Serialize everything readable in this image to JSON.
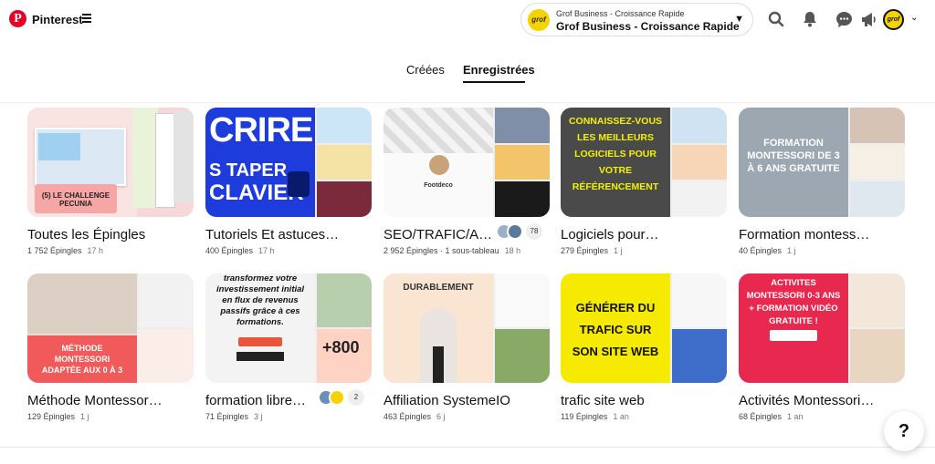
{
  "header": {
    "brand": "Pinterest",
    "account_line1": "Grof Business - Croissance Rapide",
    "account_line2": "Grof Business - Croissance Rapide",
    "avatar_text": "grof"
  },
  "tabs": {
    "created": "Créées",
    "saved": "Enregistrées"
  },
  "boards": [
    {
      "title": "Toutes les Épingles",
      "pins": "1 752 Épingles",
      "time": "17 h",
      "cover_text": "(5) LE CHALLENGE PECUNIA"
    },
    {
      "title": "Tutoriels Et astuces…",
      "pins": "400 Épingles",
      "time": "17 h",
      "cover_text": "CRIRE S TAPER CLAVIER"
    },
    {
      "title": "SEO/TRAFIC/A…",
      "pins": "2 952 Épingles",
      "sub": "1 sous-tableau",
      "time": "18 h",
      "collab_count": "78",
      "cover_text": "Footdeco"
    },
    {
      "title": "Logiciels pour…",
      "pins": "279 Épingles",
      "time": "1 j",
      "cover_text": "CONNAISSEZ-VOUS LES MEILLEURS LOGICIELS POUR VOTRE RÉFÉRENCEMENT"
    },
    {
      "title": "Formation montessori…",
      "pins": "40 Épingles",
      "time": "1 j",
      "cover_text": "FORMATION MONTESSORI DE 3 À 6 ANS GRATUITE"
    },
    {
      "title": "Méthode Montessori …",
      "pins": "129 Épingles",
      "time": "1 j",
      "cover_text": "MÉTHODE MONTESSORI ADAPTÉE AUX 0 À 3"
    },
    {
      "title": "formation libre…",
      "pins": "71 Épingles",
      "time": "3 j",
      "collab_count": "2",
      "cover_text": "transformez votre investissement initial en flux de revenus passifs grâce à ces formations."
    },
    {
      "title": "Affiliation SystemeIO",
      "pins": "463 Épingles",
      "time": "6 j",
      "cover_text": "DURABLEMENT"
    },
    {
      "title": "trafic site web",
      "pins": "119 Épingles",
      "time": "1 an",
      "cover_text": "GÉNÉRER DU TRAFIC SUR SON SITE WEB"
    },
    {
      "title": "Activités Montessori 0…",
      "pins": "68 Épingles",
      "time": "1 an",
      "cover_text": "ACTIVITES MONTESSORI 0-3 ANS + FORMATION VIDÉO GRATUITE !"
    }
  ],
  "help_label": "?"
}
